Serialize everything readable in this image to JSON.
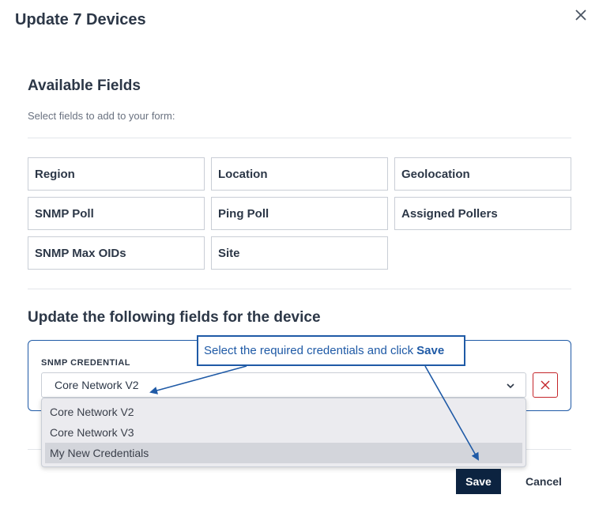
{
  "modal": {
    "title": "Update 7 Devices"
  },
  "available": {
    "title": "Available Fields",
    "hint": "Select fields to add to your form:",
    "fields": [
      "Region",
      "Location",
      "Geolocation",
      "SNMP Poll",
      "Ping Poll",
      "Assigned Pollers",
      "SNMP Max OIDs",
      "Site"
    ]
  },
  "update": {
    "title": "Update the following fields for the device",
    "credential_label": "SNMP CREDENTIAL",
    "credential_value": "Core Network V2",
    "options": [
      "Core Network V2",
      "Core Network V3",
      "My New Credentials"
    ],
    "highlighted_option": "My New Credentials"
  },
  "footer": {
    "save_label": "Save",
    "cancel_label": "Cancel"
  },
  "callout": {
    "text": "Select the required credentials and click",
    "emphasis": "Save"
  },
  "icons": {
    "close": "close-icon",
    "chevron": "chevron-down-icon",
    "remove": "x-icon"
  },
  "colors": {
    "accent": "#1f5aa6",
    "primary_button": "#0c2340",
    "danger": "#c4252a",
    "text": "#2c3747"
  }
}
